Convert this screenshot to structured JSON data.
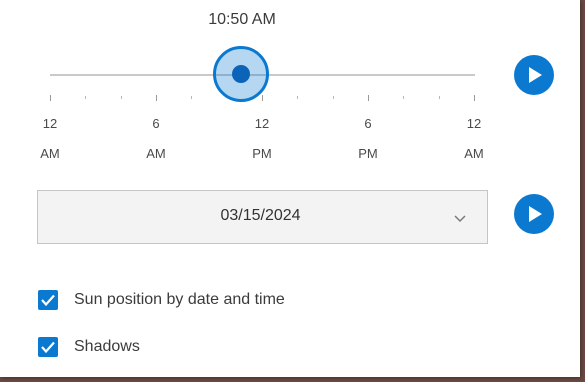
{
  "time_slider": {
    "current_time": "10:50 AM",
    "value_fraction": 0.451,
    "tick_labels": [
      {
        "hour": "12",
        "period": "AM"
      },
      {
        "hour": "6",
        "period": "AM"
      },
      {
        "hour": "12",
        "period": "PM"
      },
      {
        "hour": "6",
        "period": "PM"
      },
      {
        "hour": "12",
        "period": "AM"
      }
    ],
    "play_icon": "play-icon"
  },
  "date": {
    "value": "03/15/2024",
    "dropdown_icon": "chevron-down-icon",
    "play_icon": "play-icon"
  },
  "options": [
    {
      "label": "Sun position by date and time",
      "checked": true
    },
    {
      "label": "Shadows",
      "checked": true
    }
  ],
  "colors": {
    "accent": "#0b79d0",
    "thumb_fill": "#0b64b8",
    "text": "#3b3b3b"
  }
}
